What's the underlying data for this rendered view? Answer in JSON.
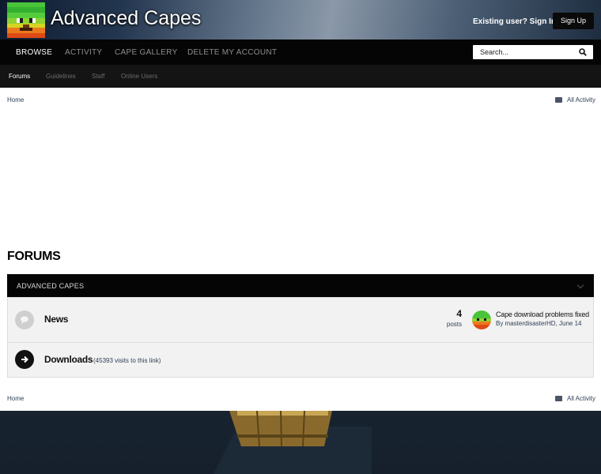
{
  "header": {
    "site_name": "Advanced Capes",
    "signin_label": "Existing user? Sign In",
    "signup_label": "Sign Up"
  },
  "nav": {
    "items": [
      {
        "label": "BROWSE",
        "active": true
      },
      {
        "label": "ACTIVITY",
        "active": false
      },
      {
        "label": "CAPE GALLERY",
        "active": false
      },
      {
        "label": "DELETE MY ACCOUNT",
        "active": false
      }
    ]
  },
  "search": {
    "placeholder": "Search..."
  },
  "subnav": {
    "items": [
      {
        "label": "Forums",
        "active": true
      },
      {
        "label": "Guidelines",
        "active": false
      },
      {
        "label": "Staff",
        "active": false
      },
      {
        "label": "Online Users",
        "active": false
      }
    ]
  },
  "breadcrumb": {
    "home": "Home",
    "all_activity": "All Activity"
  },
  "page": {
    "title": "FORUMS"
  },
  "category": {
    "title": "ADVANCED CAPES",
    "forums": [
      {
        "name": "News",
        "posts_count": "4",
        "posts_label": "posts",
        "last_post_title": "Cape download problems fixed",
        "last_post_by": "By masterdisasterHD, June 14"
      },
      {
        "name": "Downloads",
        "redirect_note": "(45393 visits to this link)"
      }
    ]
  },
  "icons": {
    "search": "search-icon",
    "dropdown": "caret-down-icon",
    "activity": "activity-icon",
    "forum": "chat-bubble-icon",
    "redirect": "arrow-right-icon",
    "chevron": "chevron-down-icon"
  },
  "colors": {
    "nav_bg": "#050505",
    "link": "#2e3f56",
    "row_bg": "#f2f2f2"
  }
}
